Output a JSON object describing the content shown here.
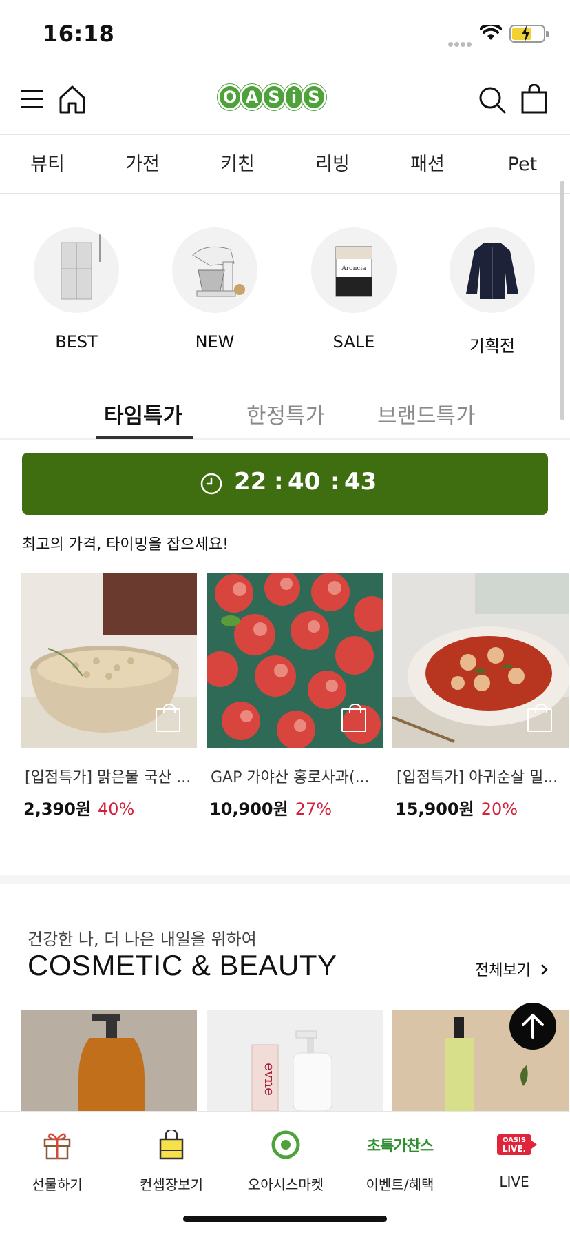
{
  "status_bar": {
    "time": "16:18"
  },
  "header": {
    "logo_letters": [
      "O",
      "A",
      "S",
      "i",
      "S"
    ],
    "icons": [
      "menu-icon",
      "home-icon",
      "search-icon",
      "cart-icon"
    ],
    "accent": "#4ea23a"
  },
  "categories": [
    "뷰티",
    "가전",
    "키친",
    "리빙",
    "패션",
    "Pet"
  ],
  "quick_links": [
    "BEST",
    "NEW",
    "SALE",
    "기획전"
  ],
  "deal_tabs": [
    "타임특가",
    "한정특가",
    "브랜드특가"
  ],
  "timer": {
    "hours": "22",
    "minutes": "40",
    "seconds": "43",
    "bg": "#3f6e10"
  },
  "timer_subtitle": "최고의 가격, 타이밍을 잡으세요!",
  "products": [
    {
      "name": "[입점특가] 맑은물 국산 ...",
      "price": "2,390원",
      "discount": "40%"
    },
    {
      "name": "GAP 가야산 홍로사과(...",
      "price": "10,900원",
      "discount": "27%"
    },
    {
      "name": "[입점특가] 아귀순살 밀...",
      "price": "15,900원",
      "discount": "20%"
    }
  ],
  "section": {
    "subtitle": "건강한 나, 더 나은 내일을 위하여",
    "title": "COSMETIC & BEAUTY",
    "view_all": "전체보기"
  },
  "bottom_nav": [
    {
      "label": "선물하기",
      "icon": "gift-icon"
    },
    {
      "label": "컨셉장보기",
      "icon": "shopping-bag-icon"
    },
    {
      "label": "오아시스마켓",
      "icon": "oasis-market-icon"
    },
    {
      "label": "이벤트/혜택",
      "icon": "event-icon",
      "badge": "초특가찬스"
    },
    {
      "label": "LIVE",
      "icon": "live-icon",
      "badge_top": "OASIS",
      "badge_bottom": "LIVE."
    }
  ]
}
